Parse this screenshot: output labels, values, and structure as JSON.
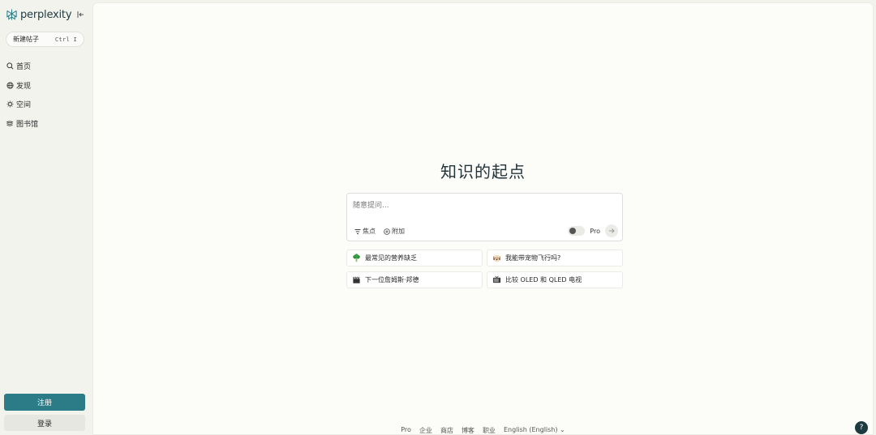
{
  "brand": {
    "name": "perplexity",
    "accent": "#2b7c86"
  },
  "sidebar": {
    "new_thread_label": "新建帖子",
    "new_thread_shortcut": "Ctrl I",
    "items": [
      {
        "label": "首页",
        "icon": "search-icon"
      },
      {
        "label": "发现",
        "icon": "globe-icon"
      },
      {
        "label": "空间",
        "icon": "spaces-icon"
      },
      {
        "label": "图书馆",
        "icon": "library-icon"
      }
    ],
    "signup_label": "注册",
    "login_label": "登录"
  },
  "main": {
    "title": "知识的起点",
    "ask": {
      "placeholder": "随意提问...",
      "focus_label": "焦点",
      "attach_label": "附加",
      "pro_label": "Pro",
      "pro_enabled": false
    },
    "suggestions": [
      {
        "label": "最常见的营养缺乏",
        "icon": "broccoli-icon"
      },
      {
        "label": "我能带宠物飞行吗?",
        "icon": "dog-icon"
      },
      {
        "label": "下一位詹姆斯·邦德",
        "icon": "clapper-icon"
      },
      {
        "label": "比较 OLED 和 QLED 电视",
        "icon": "tv-icon"
      }
    ]
  },
  "footer": {
    "links": [
      "Pro",
      "企业",
      "商店",
      "博客",
      "职业"
    ],
    "language": "English (English)"
  },
  "help_label": "?"
}
